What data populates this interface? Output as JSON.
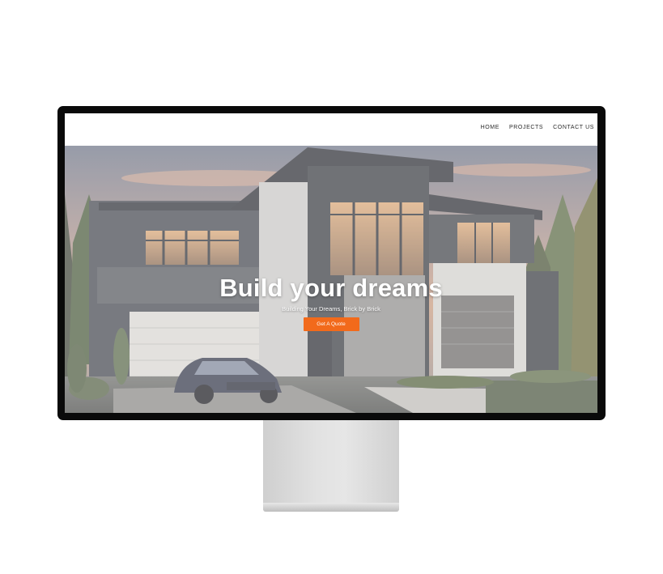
{
  "nav": {
    "items": [
      {
        "label": "HOME"
      },
      {
        "label": "PROJECTS"
      },
      {
        "label": "CONTACT US"
      }
    ]
  },
  "hero": {
    "title": "Build your dreams",
    "subtitle": "Building Your Dreams, Brick by Brick",
    "cta_label": "Get A Quote",
    "image": "modern-house-with-car-at-dusk"
  },
  "colors": {
    "accent": "#f26a1b",
    "monitor_bezel": "#0a0a0a",
    "nav_background": "#ffffff",
    "stand": "#dcdcdc"
  }
}
